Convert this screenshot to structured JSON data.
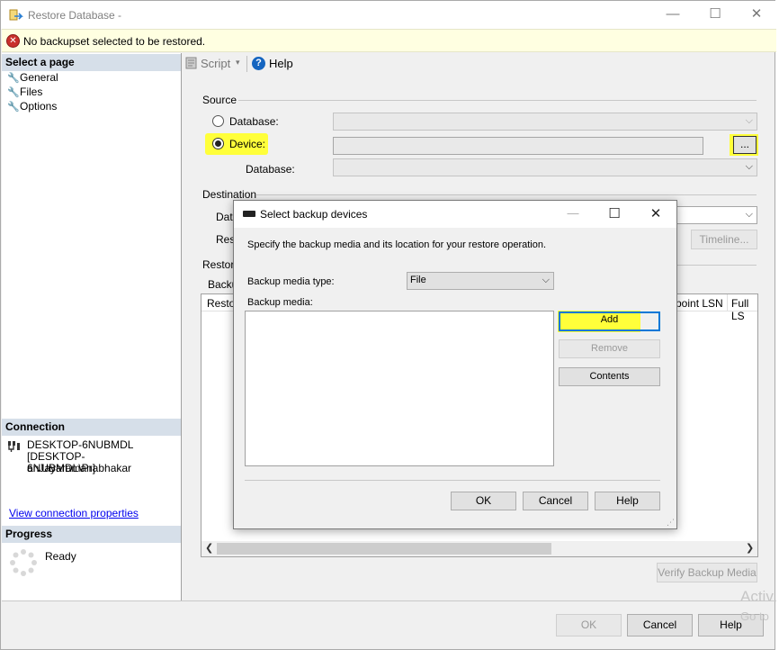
{
  "window": {
    "title": "Restore Database -",
    "controls": {
      "minimize": "—",
      "maximize": "☐",
      "close": "✕"
    }
  },
  "error_bar": {
    "message": "No backupset selected to be restored."
  },
  "left_pane": {
    "select_page_header": "Select a page",
    "pages": [
      {
        "label": "General",
        "icon": "wrench-icon"
      },
      {
        "label": "Files",
        "icon": "wrench-icon"
      },
      {
        "label": "Options",
        "icon": "wrench-icon"
      }
    ],
    "connection_header": "Connection",
    "connection_server": "DESKTOP-6NUBMDL",
    "connection_user_line1": "[DESKTOP-6NUBMDL\\Prabhakar",
    "connection_user_line2": "anJayaraman]",
    "view_connection_link": "View connection properties",
    "progress_header": "Progress",
    "progress_status": "Ready"
  },
  "toolbar": {
    "script_label": "Script",
    "help_label": "Help"
  },
  "source": {
    "label": "Source",
    "database_option": "Database:",
    "device_option": "Device:",
    "selected_option": "Device",
    "browse_button": "...",
    "device_database_label": "Database:"
  },
  "destination": {
    "label": "Destination",
    "database_label_partial": "Data",
    "restore_to_partial": "Rest",
    "timeline_button": "Timeline..."
  },
  "restore_plan": {
    "label_partial": "Restore",
    "backup_sets_partial": "Backu",
    "columns_left_partial": "Restor",
    "column_checkpoint_lsn": "point LSN",
    "column_full_lsn": "Full LS"
  },
  "main_buttons": {
    "verify": "Verify Backup Media",
    "ok": "OK",
    "cancel": "Cancel",
    "help": "Help"
  },
  "watermark": {
    "line1": "Activ",
    "line2": "Go to"
  },
  "dialog": {
    "title": "Select backup devices",
    "controls": {
      "minimize": "—",
      "maximize": "☐",
      "close": "✕"
    },
    "description": "Specify the backup media and its location for your restore operation.",
    "media_type_label": "Backup media type:",
    "media_type_value": "File",
    "media_list_label": "Backup media:",
    "add_button": "Add",
    "remove_button": "Remove",
    "contents_button": "Contents",
    "ok_button": "OK",
    "cancel_button": "Cancel",
    "help_button": "Help"
  },
  "colors": {
    "highlight": "#ffff3a",
    "pane_header": "#d6dfe9",
    "error_bar": "#ffffe1",
    "link": "#0000ee",
    "focus_border": "#0078d7"
  }
}
